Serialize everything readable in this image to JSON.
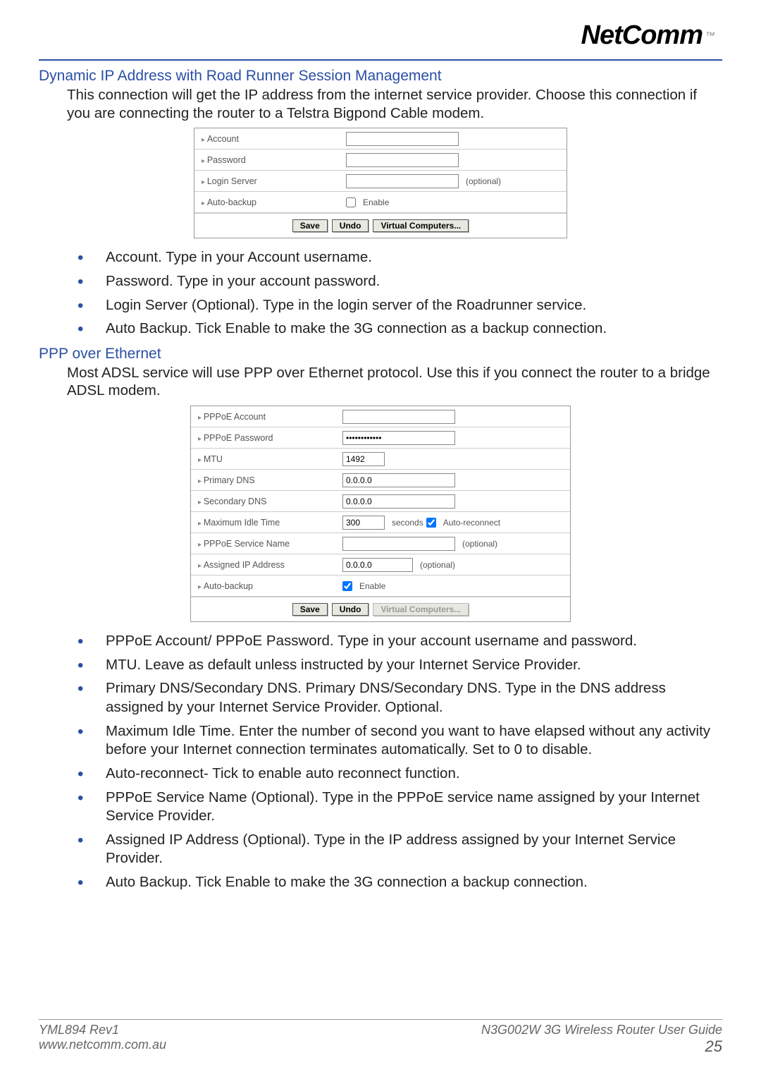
{
  "brand": {
    "name": "NetComm",
    "tm": "™"
  },
  "section1": {
    "heading": "Dynamic IP Address with Road Runner Session Management",
    "intro": "This connection will get the IP address from the internet service provider. Choose this connection if you are connecting the router to a Telstra Bigpond Cable modem.",
    "rows": {
      "account_label": "Account",
      "password_label": "Password",
      "login_server_label": "Login Server",
      "login_server_optional": "(optional)",
      "autobackup_label": "Auto-backup",
      "autobackup_text": "Enable"
    },
    "buttons": {
      "save": "Save",
      "undo": "Undo",
      "vc": "Virtual Computers..."
    },
    "bullets": [
      "Account. Type in your Account username.",
      "Password. Type in your account password.",
      "Login Server (Optional). Type in the login server of the Roadrunner service.",
      "Auto Backup. Tick Enable to make the 3G connection as a backup connection."
    ]
  },
  "section2": {
    "heading": "PPP over Ethernet",
    "intro": "Most ADSL service will use PPP over Ethernet protocol. Use this if you connect the router to a bridge ADSL modem.",
    "rows": {
      "account_label": "PPPoE Account",
      "password_label": "PPPoE Password",
      "password_value": "************",
      "mtu_label": "MTU",
      "mtu_value": "1492",
      "pdns_label": "Primary DNS",
      "pdns_value": "0.0.0.0",
      "sdns_label": "Secondary DNS",
      "sdns_value": "0.0.0.0",
      "idle_label": "Maximum Idle Time",
      "idle_value": "300",
      "idle_seconds": "seconds",
      "idle_auto": "Auto-reconnect",
      "svc_label": "PPPoE Service Name",
      "svc_optional": "(optional)",
      "ip_label": "Assigned IP Address",
      "ip_value": "0.0.0.0",
      "ip_optional": "(optional)",
      "ab_label": "Auto-backup",
      "ab_text": "Enable"
    },
    "buttons": {
      "save": "Save",
      "undo": "Undo",
      "vc": "Virtual Computers..."
    },
    "bullets": [
      "PPPoE Account/ PPPoE Password. Type in your account username and password.",
      "MTU. Leave as default unless instructed by your Internet Service Provider.",
      "Primary DNS/Secondary DNS. Primary DNS/Secondary DNS. Type in the DNS address assigned by your Internet Service Provider. Optional.",
      "Maximum Idle Time. Enter the number of second you want to have elapsed without any activity before your Internet connection terminates automatically. Set to 0 to disable.",
      "Auto-reconnect- Tick to enable auto reconnect function.",
      "PPPoE Service Name (Optional). Type in the PPPoE service name assigned by your Internet Service Provider.",
      "Assigned IP Address (Optional). Type in the IP address assigned by your Internet Service Provider.",
      "Auto Backup. Tick Enable to make the 3G connection a backup connection."
    ]
  },
  "footer": {
    "rev": "YML894 Rev1",
    "url": "www.netcomm.com.au",
    "guide": "N3G002W 3G Wireless Router User Guide",
    "page": "25"
  }
}
